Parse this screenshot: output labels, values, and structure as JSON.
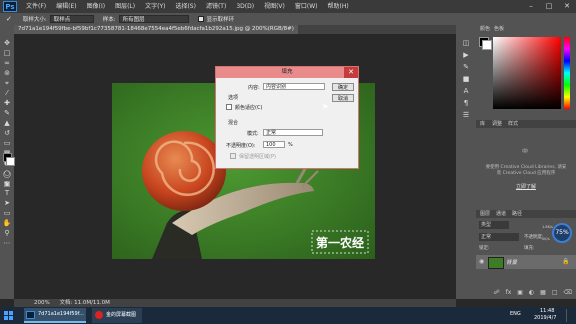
{
  "app": {
    "logo": "Ps"
  },
  "menu": [
    "文件(F)",
    "编辑(E)",
    "图像(I)",
    "图层(L)",
    "文字(Y)",
    "选择(S)",
    "滤镜(T)",
    "3D(D)",
    "视图(V)",
    "窗口(W)",
    "帮助(H)"
  ],
  "options_bar": {
    "sample_size_label": "取样大小:",
    "sample_size_value": "取样点",
    "sample_label": "样本:",
    "sample_value": "所有图层",
    "show_ring_label": "显示取样环"
  },
  "document": {
    "tab": "7d71a1e194f59fbe-bf59bf1c77358781-18468e7554ea4f5eb6fdacfa1b292a15.jpg @ 200%(RGB/8#)",
    "zoom": "200%",
    "doc_size": "文档: 11.0M/11.0M",
    "watermark": "第一农经"
  },
  "fill_dialog": {
    "title": "填充",
    "contents_label": "内容:",
    "contents_value": "内容识别",
    "options_label": "选项",
    "color_adapt_label": "颜色适应(C)",
    "blending_label": "混合",
    "mode_label": "模式:",
    "mode_value": "正常",
    "opacity_label": "不透明度(O):",
    "opacity_value": "100",
    "opacity_unit": "%",
    "preserve_transparency_label": "保留透明区域(P)",
    "ok_label": "确定",
    "cancel_label": "取消"
  },
  "panels": {
    "color_tabs": [
      "颜色",
      "色板"
    ],
    "adjust_tabs": [
      "库",
      "调整",
      "样式"
    ],
    "cc_text": "要使用 Creative Cloud Libraries, 请安装 Creative Cloud 应用程序",
    "cc_link": "立即了解",
    "layers_tabs": [
      "图层",
      "通道",
      "路径"
    ],
    "kind_label": "类型",
    "blend_value": "正常",
    "opacity_label": "不透明度:",
    "lock_label": "锁定:",
    "fill_label": "填充:",
    "layer_name": "背景",
    "percent_badge": "75%",
    "speed_up": "1.8K/s",
    "speed_down": "0K/s"
  },
  "taskbar": {
    "items": [
      "7d71a1e194f59f...",
      "金的屏幕截图"
    ],
    "lang": "ENG",
    "time": "11:48",
    "date": "2019/4/7"
  }
}
